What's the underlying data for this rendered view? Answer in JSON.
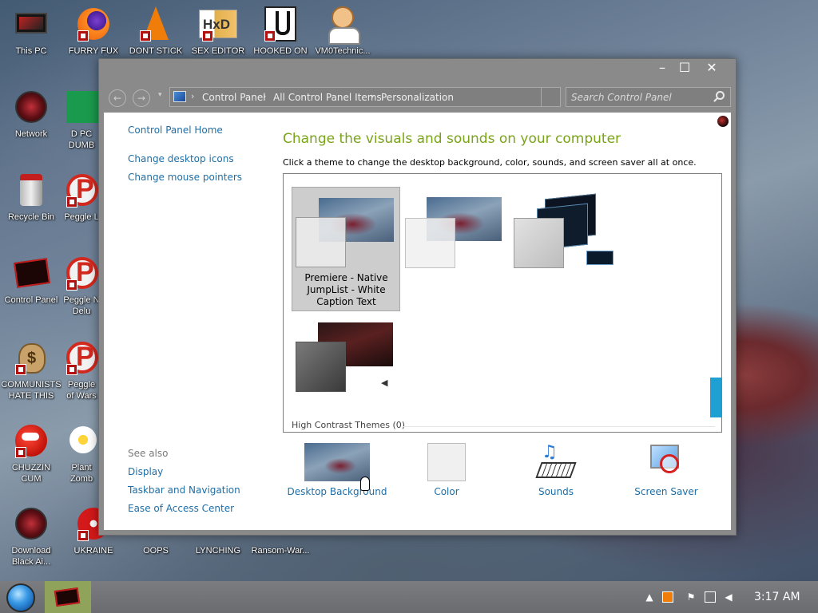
{
  "desktop": {
    "icons": [
      {
        "label": "This PC",
        "icon": "this-pc-icon"
      },
      {
        "label": "FURRY FUX",
        "icon": "firefox-icon"
      },
      {
        "label": "DONT STICK",
        "icon": "vlc-cone-icon"
      },
      {
        "label": "SEX EDITOR",
        "icon": "hxd-icon"
      },
      {
        "label": "HOOKED ON",
        "icon": "hook-icon"
      },
      {
        "label": "VM0Technic...",
        "icon": "doctor-icon"
      },
      {
        "label": "Network",
        "icon": "network-orb-icon"
      },
      {
        "label": "D PC DUMB",
        "icon": "green-app-icon"
      },
      {
        "label": "Recycle Bin",
        "icon": "recycle-bin-icon"
      },
      {
        "label": "Peggle L",
        "icon": "peggle-icon"
      },
      {
        "label": "Control Panel",
        "icon": "control-panel-icon"
      },
      {
        "label": "Peggle N Delu",
        "icon": "peggle-icon"
      },
      {
        "label": "COMMUNISTS HATE THIS G...",
        "icon": "money-bag-icon"
      },
      {
        "label": "Peggle of Wars",
        "icon": "peggle-icon"
      },
      {
        "label": "CHUZZIN CUM",
        "icon": "chuzzle-icon"
      },
      {
        "label": "Plant Zomb",
        "icon": "flower-icon"
      },
      {
        "label": "Download Black Ai...",
        "icon": "download-orb-icon"
      },
      {
        "label": "UKRAINE",
        "icon": "saw-icon"
      },
      {
        "label": "OOPS",
        "icon": "app-icon"
      },
      {
        "label": "LYNCHING",
        "icon": "app-icon"
      },
      {
        "label": "Ransom-War...",
        "icon": "app-icon"
      }
    ]
  },
  "window": {
    "buttons": {
      "minimize": "–",
      "maximize": "☐",
      "close": "✕"
    },
    "nav": {
      "back": "←",
      "forward": "→",
      "dropdown": "▾"
    },
    "breadcrumb": [
      "Control Panel",
      "All Control Panel Items",
      "Personalization"
    ],
    "breadcrumb_sep": "›",
    "search": {
      "placeholder": "Search Control Panel",
      "value": ""
    }
  },
  "sidebar": {
    "home": "Control Panel Home",
    "links": [
      "Change desktop icons",
      "Change mouse pointers"
    ],
    "see_also_title": "See also",
    "see_also": [
      "Display",
      "Taskbar and Navigation",
      "Ease of Access Center"
    ]
  },
  "main": {
    "title": "Change the visuals and sounds on your computer",
    "subtitle": "Click a theme to change the desktop background, color, sounds, and screen saver all at once.",
    "themes": [
      {
        "name": "Premiere - Native JumpList - White Caption Text",
        "selected": true
      },
      {
        "name": "",
        "selected": false
      },
      {
        "name": "",
        "selected": false
      },
      {
        "name": "",
        "selected": false
      }
    ],
    "high_contrast_label": "High Contrast Themes (0)"
  },
  "bottom": {
    "items": [
      {
        "label": "Desktop Background",
        "icon": "desktop-background-icon"
      },
      {
        "label": "Color",
        "icon": "color-swatch-icon"
      },
      {
        "label": "Sounds",
        "icon": "sounds-icon"
      },
      {
        "label": "Screen Saver",
        "icon": "screen-saver-icon"
      }
    ]
  },
  "taskbar": {
    "clock": "3:17 AM",
    "tray": [
      "chevron-up-icon",
      "notification-icon",
      "flag-icon",
      "network-icon",
      "volume-icon"
    ]
  },
  "colors": {
    "headline": "#79a318",
    "link": "#1e6ea6",
    "accent_scroll": "#1ea0d2",
    "taskbar_active": "#8fa45a"
  }
}
